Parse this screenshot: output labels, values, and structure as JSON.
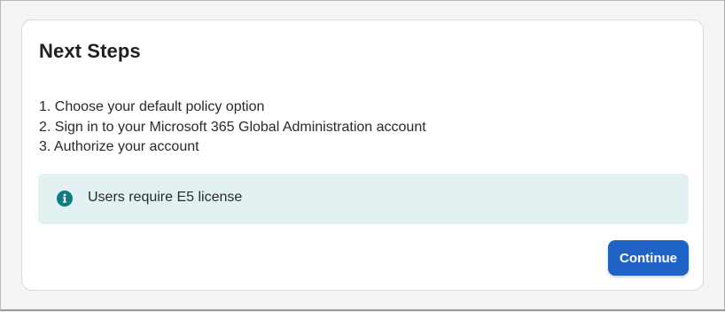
{
  "dialog": {
    "title": "Next Steps",
    "steps": [
      "1. Choose your default policy option",
      "2. Sign in to your Microsoft 365 Global Administration account",
      "3. Authorize your account"
    ],
    "notice": {
      "icon": "info-icon",
      "text": "Users require E5 license",
      "color": "#e4f1f3",
      "icon_color": "#0e7c86"
    },
    "continue_label": "Continue",
    "accent": "#1f63c6"
  }
}
